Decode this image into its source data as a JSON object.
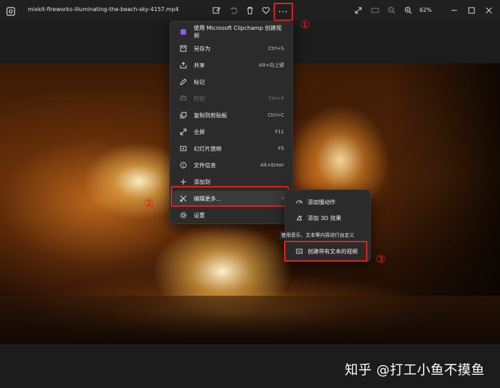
{
  "titlebar": {
    "filename": "mixkit-fireworks-illuminating-the-beach-sky-4157.mp4",
    "zoom": "62%",
    "more_label": "···",
    "icons": [
      "photo-app-icon",
      "edit-icon",
      "rotate-icon",
      "delete-icon",
      "favorite-icon",
      "more-icon",
      "fullscreen-icon",
      "fit-icon",
      "zoom-out-icon",
      "zoom-in-icon",
      "minimize-icon",
      "maximize-icon",
      "close-icon"
    ]
  },
  "annotations": {
    "one": "①",
    "two": "②",
    "three": "③"
  },
  "menu": {
    "items": [
      {
        "label": "使用 Microsoft Clipchamp 创建视频",
        "shortcut": "",
        "icon": "clipchamp-icon"
      },
      {
        "label": "另存为",
        "shortcut": "Ctrl+S",
        "icon": "save-icon"
      },
      {
        "label": "共享",
        "shortcut": "Alt+向上键",
        "icon": "share-icon"
      },
      {
        "label": "标记",
        "shortcut": "",
        "icon": "markup-icon"
      },
      {
        "label": "打印",
        "shortcut": "Ctrl+P",
        "icon": "print-icon",
        "disabled": true
      },
      {
        "label": "复制到剪贴板",
        "shortcut": "Ctrl+C",
        "icon": "copy-icon"
      },
      {
        "label": "全屏",
        "shortcut": "F11",
        "icon": "fullscreen-icon"
      },
      {
        "label": "幻灯片放映",
        "shortcut": "F5",
        "icon": "slideshow-icon"
      },
      {
        "label": "文件信息",
        "shortcut": "Alt+Enter",
        "icon": "info-icon"
      },
      {
        "label": "添加到",
        "shortcut": "",
        "icon": "add-icon"
      },
      {
        "label": "编辑更多...",
        "shortcut": "",
        "icon": "edit-more-icon",
        "has_submenu": true
      },
      {
        "label": "设置",
        "shortcut": "",
        "icon": "settings-icon"
      }
    ]
  },
  "submenu": {
    "items": [
      {
        "label": "添加慢动作",
        "icon": "slow-motion-icon"
      },
      {
        "label": "添加 3D 效果",
        "icon": "3d-effect-icon"
      },
      {
        "label": "创建带有文本的视频",
        "icon": "text-video-icon"
      }
    ],
    "tooltip": "使用音乐、文本等内容进行自定义"
  },
  "watermark": "知乎 @打工小鱼不摸鱼",
  "colors": {
    "accent_red": "#e0241b",
    "menu_bg": "#2b2b2b",
    "titlebar_bg": "#202020"
  }
}
